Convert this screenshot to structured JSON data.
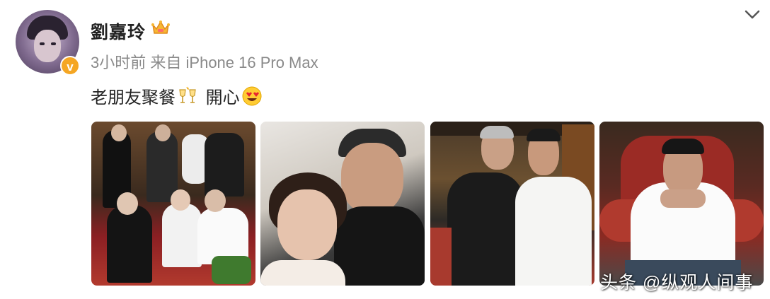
{
  "post": {
    "author": "劉嘉玲",
    "author_badge_icon": "crown-icon",
    "verified_badge": "v",
    "verified_color": "#f5a623",
    "time": "3小时前",
    "source_prefix": "来自",
    "source_device": "iPhone 16 Pro Max",
    "text_part1": "老朋友聚餐",
    "text_emoji1": "cheers-icon",
    "text_part2": " 開心",
    "text_emoji2": "heart-eyes-icon",
    "menu_icon": "chevron-down-icon",
    "images": [
      {
        "name": "group-dinner-photo"
      },
      {
        "name": "selfie-photo"
      },
      {
        "name": "two-men-photo"
      },
      {
        "name": "man-in-chair-photo"
      }
    ],
    "watermark": "头条 @纵观人间事"
  }
}
